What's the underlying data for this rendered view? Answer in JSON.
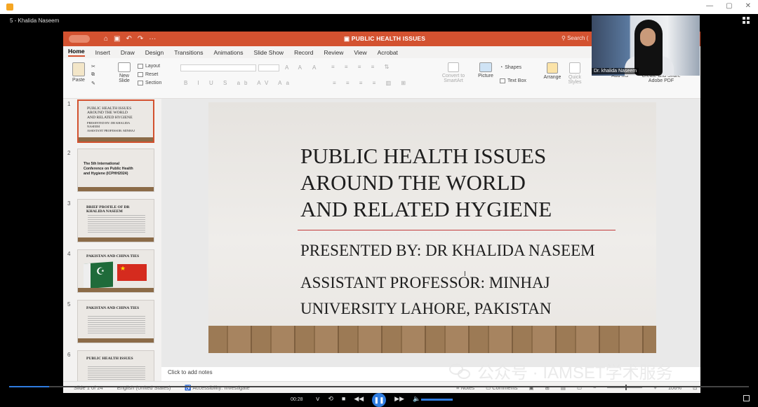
{
  "meeting": {
    "title": "5 - Khalida Naseem"
  },
  "ppt": {
    "doc_title": "PUBLIC HEALTH ISSUES",
    "search_label": "Search (",
    "tabs": [
      "Home",
      "Insert",
      "Draw",
      "Design",
      "Transitions",
      "Animations",
      "Slide Show",
      "Record",
      "Review",
      "View",
      "Acrobat"
    ],
    "ribbon": {
      "paste": "Paste",
      "new_slide": "New Slide",
      "layout": "Layout",
      "reset": "Reset",
      "section": "Section",
      "convert_smartart": "Convert to SmartArt",
      "picture": "Picture",
      "shapes": "Shapes",
      "text_box": "Text Box",
      "arrange": "Arrange",
      "quick_styles": "Quick Styles",
      "add_ins": "Add-ins",
      "create_share_pdf": "Create and Share Adobe PDF"
    },
    "thumbnails": [
      {
        "num": "1",
        "lines": [
          "PUBLIC HEALTH ISSUES",
          "AROUND THE WORLD",
          "AND RELATED HYGIENE",
          "PRESENTED BY: DR KHALIDA",
          "NASEEM",
          "ASSISTANT PROFESSOR: MINHAJ"
        ]
      },
      {
        "num": "2",
        "lines": [
          "The 5th International",
          "Conference on Public Health",
          "and Hygiene (ICPHH2024)"
        ]
      },
      {
        "num": "3",
        "lines": [
          "BRIEF PROFILE OF DR",
          "KHALIDA NASEEM"
        ]
      },
      {
        "num": "4",
        "lines": [
          "PAKISTAN AND CHINA TIES"
        ]
      },
      {
        "num": "5",
        "lines": [
          "PAKISTAN AND CHINA TIES"
        ]
      },
      {
        "num": "6",
        "lines": [
          "PUBLIC HEALTH ISSUES"
        ]
      }
    ],
    "slide": {
      "title_lines": [
        "PUBLIC HEALTH ISSUES",
        "AROUND THE WORLD",
        "AND RELATED HYGIENE"
      ],
      "presented_by": "PRESENTED BY: DR KHALIDA NASEEM",
      "position": "ASSISTANT PROFESSOR: MINHAJ UNIVERSITY LAHORE, PAKISTAN"
    },
    "notes_placeholder": "Click to add notes",
    "status": {
      "slide_info": "Slide 1 of 24",
      "language": "English (United States)",
      "accessibility": "Accessibility: Investigate",
      "notes": "Notes",
      "comments": "Comments",
      "zoom": "106%"
    }
  },
  "webcam": {
    "name": "Dr. khalida Naseem"
  },
  "watermark": {
    "text": "公众号 · IAMSET学术服务"
  },
  "player": {
    "time": "00:28",
    "progress_fraction": 0.054
  },
  "colors": {
    "ppt_accent": "#d35230",
    "player_accent": "#2f7ce0"
  }
}
